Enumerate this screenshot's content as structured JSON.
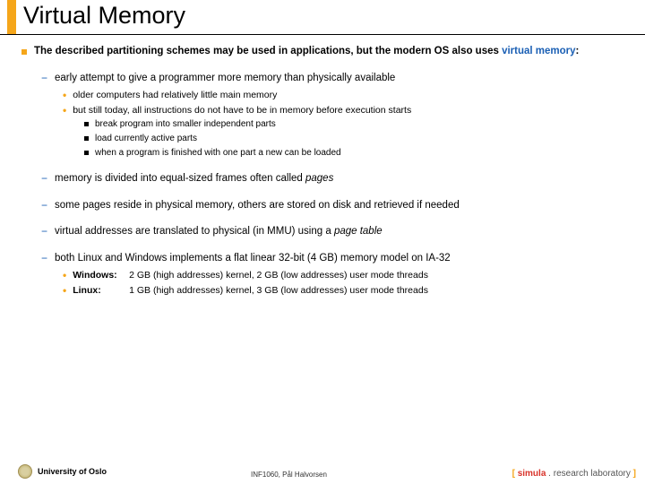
{
  "title": "Virtual Memory",
  "intro": {
    "pre": "The described partitioning schemes may be used in applications, but the modern OS also uses ",
    "vm": "virtual memory",
    "post": ":"
  },
  "p1": {
    "text": "early attempt to give a programmer more memory than physically available",
    "s1": "older computers had relatively little main memory",
    "s2": "but still today, all instructions do not have to be in memory before execution starts",
    "s2a": "break program into smaller independent parts",
    "s2b": "load currently active parts",
    "s2c": "when a program is finished with one part a new can be loaded"
  },
  "p2": {
    "pre": "memory is divided into equal-sized frames often called ",
    "it": "pages"
  },
  "p3": "some pages reside in physical memory, others are stored on disk and retrieved if needed",
  "p4": {
    "pre": "virtual addresses are translated to physical (in MMU) using a ",
    "it": "page table"
  },
  "p5": {
    "text": "both Linux and Windows implements a flat linear 32-bit (4 GB) memory model on IA-32",
    "win_label": "Windows:",
    "win_text": "2 GB (high addresses) kernel, 2 GB (low addresses) user mode threads",
    "lin_label": "Linux:",
    "lin_text": "1 GB (high addresses) kernel, 3 GB (low addresses) user mode threads"
  },
  "footer": {
    "uni": "University of Oslo",
    "course": "INF1060, Pål Halvorsen",
    "br_l": "[ ",
    "br_s": "simula",
    "br_dot": " . ",
    "br_r": "research laboratory",
    "br_e": " ]"
  }
}
